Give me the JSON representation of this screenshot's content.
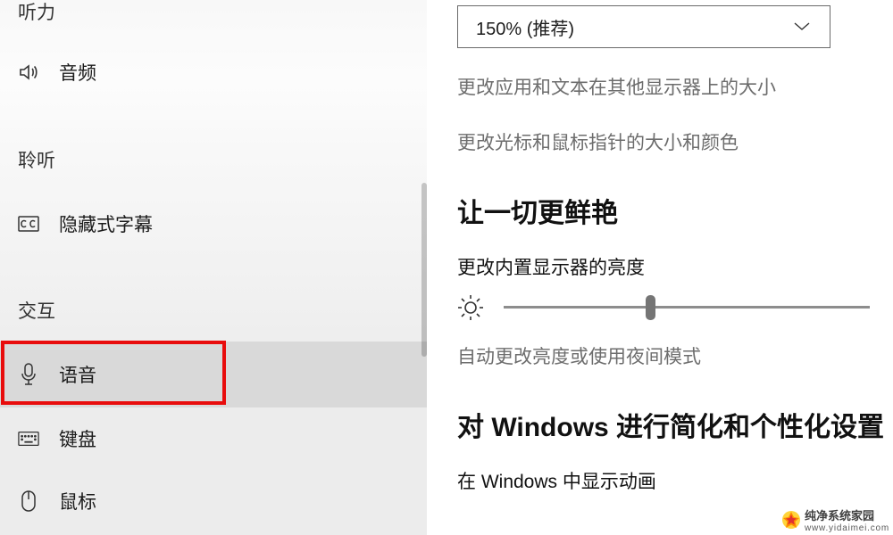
{
  "sidebar": {
    "sections": {
      "hearing": "听力",
      "listen": "聆听",
      "interaction": "交互"
    },
    "items": {
      "audio": {
        "label": "音频"
      },
      "cc": {
        "label": "隐藏式字幕"
      },
      "speech": {
        "label": "语音"
      },
      "keyboard": {
        "label": "键盘"
      },
      "mouse": {
        "label": "鼠标"
      }
    }
  },
  "content": {
    "scale_dropdown": {
      "value": "150% (推荐)"
    },
    "link_other_displays": "更改应用和文本在其他显示器上的大小",
    "link_cursor": "更改光标和鼠标指针的大小和颜色",
    "vivid_heading": "让一切更鲜艳",
    "brightness_label": "更改内置显示器的亮度",
    "brightness_percent": 40,
    "auto_brightness_link": "自动更改亮度或使用夜间模式",
    "simplify_heading": "对 Windows 进行简化和个性化设置",
    "show_animations_label": "在 Windows 中显示动画"
  },
  "watermark": {
    "title": "纯净系统家园",
    "url": "www.yidaimei.com"
  }
}
